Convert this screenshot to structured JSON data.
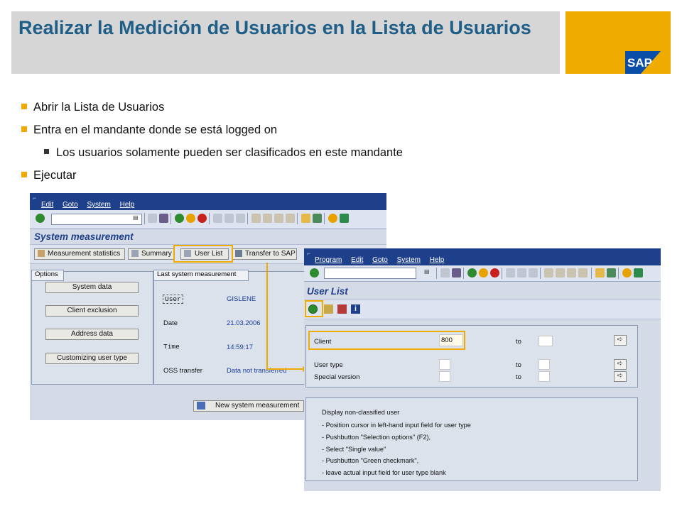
{
  "slide": {
    "title": "Realizar la Medición de Usuarios en la Lista de Usuarios",
    "bullets": [
      "Abrir la Lista de Usuarios",
      "Entra en el mandante donde se está logged on",
      "Los usuarios solamente pueden ser clasificados en este mandante",
      "Ejecutar"
    ]
  },
  "colors": {
    "brand_yellow": "#f0ab00",
    "title_blue": "#1f5e87",
    "highlight": "#f0ab00",
    "sap_blue": "#1e3f8a"
  },
  "left_window": {
    "menu": [
      "Edit",
      "Goto",
      "System",
      "Help"
    ],
    "title": "System measurement",
    "app_buttons": [
      "Measurement statistics",
      "Summary",
      "User List",
      "Transfer to SAP"
    ],
    "options_tab": "Options",
    "last_tab": "Last system measurement",
    "option_buttons": [
      "System data",
      "Client exclusion",
      "Address data",
      "Customizing user type"
    ],
    "fields": [
      {
        "label": "User",
        "value": "GISLENE"
      },
      {
        "label": "Date",
        "value": "21.03.2006"
      },
      {
        "label": "Time",
        "value": "14:59:17"
      },
      {
        "label": "OSS transfer",
        "value": "Data not transferred"
      }
    ],
    "new_measurement_button": "New system measurement"
  },
  "right_window": {
    "menu": [
      "Program",
      "Edit",
      "Goto",
      "System",
      "Help"
    ],
    "title": "User List",
    "client_label": "Client",
    "client_value": "800",
    "to_label": "to",
    "user_type_label": "User type",
    "special_version_label": "Special version",
    "notes": [
      "Display non-classified user",
      "- Position cursor in left-hand input field for user type",
      "- Pushbutton \"Selection options\" (F2),",
      "- Select \"Single value\"",
      "- Pushbutton \"Green checkmark\",",
      "- leave actual input field for user type blank"
    ]
  }
}
